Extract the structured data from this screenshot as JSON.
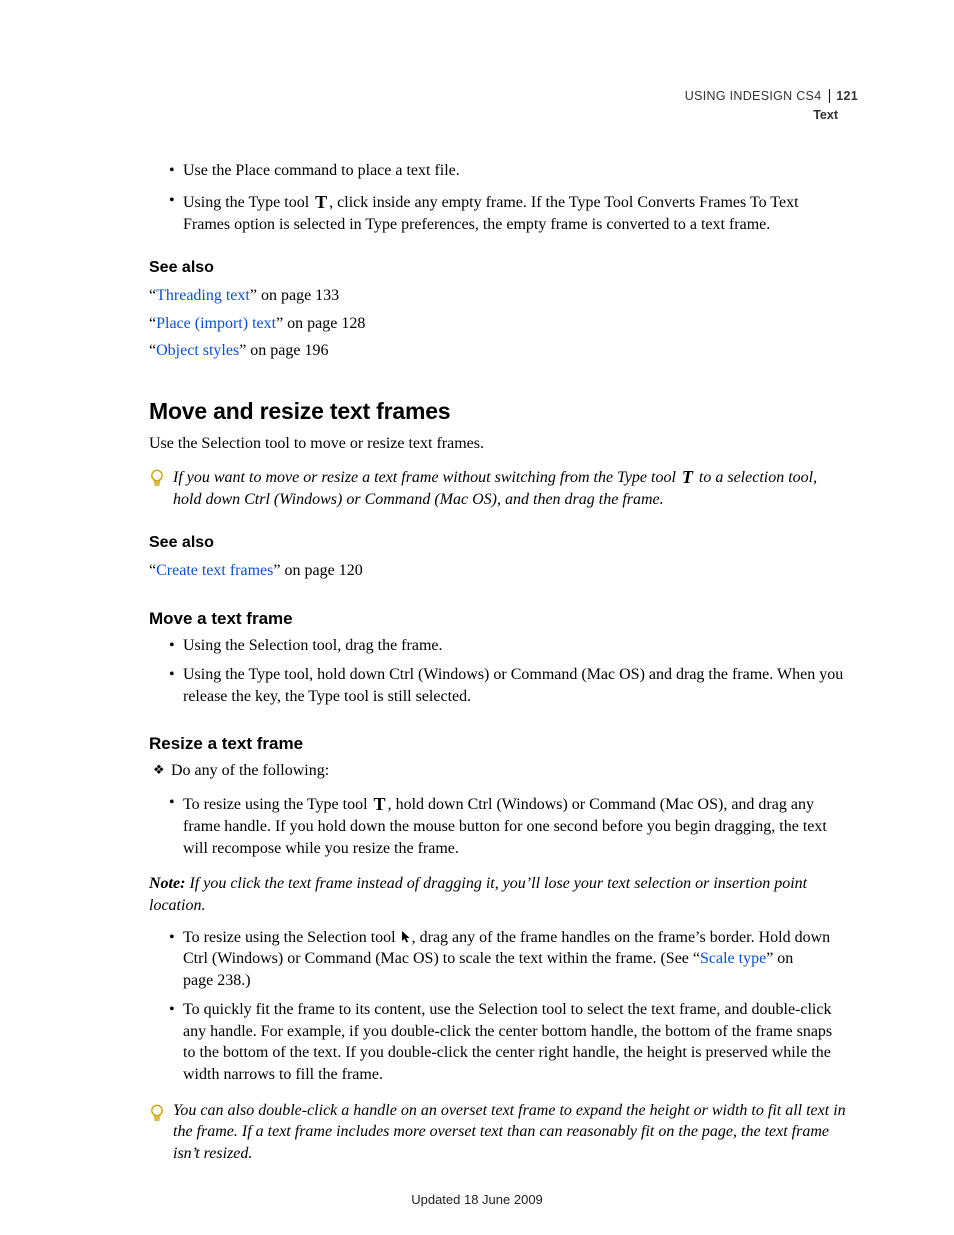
{
  "header": {
    "product": "USING INDESIGN CS4",
    "section": "Text",
    "page_number": "121"
  },
  "intro_bullets": [
    {
      "text": "Use the Place command to place a text file."
    },
    {
      "prefix": "Using the Type tool ",
      "icon": "type-tool",
      "suffix": ", click inside any empty frame. If the Type Tool Converts Frames To Text Frames option is selected in Type preferences, the empty frame is converted to a text frame."
    }
  ],
  "see_also_1": {
    "heading": "See also",
    "items": [
      {
        "link": "Threading text",
        "tail": "” on page 133"
      },
      {
        "link": "Place (import) text",
        "tail": "” on page 128"
      },
      {
        "link": "Object styles",
        "tail": "” on page 196"
      }
    ]
  },
  "move_resize": {
    "heading": "Move and resize text frames",
    "para": "Use the Selection tool to move or resize text frames.",
    "tip_prefix": "If you want to move or resize a text frame without switching from the Type tool ",
    "tip_icon": "type-tool",
    "tip_suffix": " to a selection tool, hold down Ctrl (Windows) or Command (Mac OS), and then drag the frame."
  },
  "see_also_2": {
    "heading": "See also",
    "items": [
      {
        "link": "Create text frames",
        "tail": "” on page 120"
      }
    ]
  },
  "move_frame": {
    "heading": "Move a text frame",
    "bullets": [
      "Using the Selection tool, drag the frame.",
      "Using the Type tool, hold down Ctrl (Windows) or Command (Mac OS) and drag the frame. When you release the key, the Type tool is still selected."
    ]
  },
  "resize_frame": {
    "heading": "Resize a text frame",
    "lead": "Do any of the following:",
    "b1_prefix": "To resize using the Type tool ",
    "b1_icon": "type-tool",
    "b1_suffix": ", hold down Ctrl (Windows) or Command (Mac OS), and drag any frame handle. If you hold down the mouse button for one second before you begin dragging, the text will recompose while you resize the frame.",
    "note_label": "Note:",
    "note_body": " If you click the text frame instead of dragging it, you’ll lose your text selection or insertion point location.",
    "b2_prefix": "To resize using the Selection tool ",
    "b2_icon": "selection-tool",
    "b2_mid": ", drag any of the frame handles on the frame’s border. Hold down Ctrl (Windows) or Command (Mac OS) to scale the text within the frame. (See “",
    "b2_link": "Scale type",
    "b2_tail": "” on page 238.)",
    "b3": "To quickly fit the frame to its content, use the Selection tool to select the text frame, and double-click any handle. For example, if you double-click the center bottom handle, the bottom of the frame snaps to the bottom of the text. If you double-click the center right handle, the height is preserved while the width narrows to fill the frame.",
    "tip2": "You can also double-click a handle on an overset text frame to expand the height or width to fit all text in the frame. If a text frame includes more overset text than can reasonably fit on the page, the text frame isn’t resized."
  },
  "footer": "Updated 18 June 2009"
}
